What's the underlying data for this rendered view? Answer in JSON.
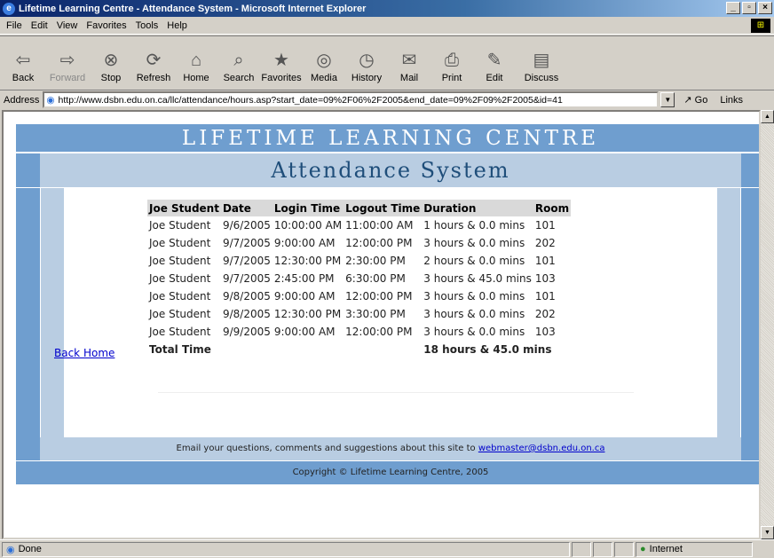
{
  "window": {
    "title": "Lifetime Learning Centre - Attendance System - Microsoft Internet Explorer"
  },
  "menu": [
    "File",
    "Edit",
    "View",
    "Favorites",
    "Tools",
    "Help"
  ],
  "toolbar": [
    {
      "label": "Back",
      "icon": "back-arrow-icon",
      "glyph": "⇦"
    },
    {
      "label": "Forward",
      "icon": "forward-arrow-icon",
      "glyph": "⇨"
    },
    {
      "label": "Stop",
      "icon": "stop-icon",
      "glyph": "⊗"
    },
    {
      "label": "Refresh",
      "icon": "refresh-icon",
      "glyph": "⟳"
    },
    {
      "label": "Home",
      "icon": "home-icon",
      "glyph": "⌂"
    },
    {
      "label": "Search",
      "icon": "search-icon",
      "glyph": "⌕"
    },
    {
      "label": "Favorites",
      "icon": "favorites-icon",
      "glyph": "★"
    },
    {
      "label": "Media",
      "icon": "media-icon",
      "glyph": "◎"
    },
    {
      "label": "History",
      "icon": "history-icon",
      "glyph": "◷"
    },
    {
      "label": "Mail",
      "icon": "mail-icon",
      "glyph": "✉"
    },
    {
      "label": "Print",
      "icon": "print-icon",
      "glyph": "⎙"
    },
    {
      "label": "Edit",
      "icon": "edit-icon",
      "glyph": "✎"
    },
    {
      "label": "Discuss",
      "icon": "discuss-icon",
      "glyph": "▤"
    }
  ],
  "address": {
    "label": "Address",
    "url": "http://www.dsbn.edu.on.ca/llc/attendance/hours.asp?start_date=09%2F06%2F2005&end_date=09%2F09%2F2005&id=41",
    "go": "Go",
    "links": "Links"
  },
  "page": {
    "header_title": "LIFETIME LEARNING CENTRE",
    "subtitle": "Attendance System",
    "columns": [
      "Joe Student",
      "Date",
      "Login Time",
      "Logout Time",
      "Duration",
      "Room"
    ],
    "rows": [
      [
        "Joe Student",
        "9/6/2005",
        "10:00:00 AM",
        "11:00:00 AM",
        "1 hours & 0.0 mins",
        "101"
      ],
      [
        "Joe Student",
        "9/7/2005",
        "9:00:00 AM",
        "12:00:00 PM",
        "3 hours & 0.0 mins",
        "202"
      ],
      [
        "Joe Student",
        "9/7/2005",
        "12:30:00 PM",
        "2:30:00 PM",
        "2 hours & 0.0 mins",
        "101"
      ],
      [
        "Joe Student",
        "9/7/2005",
        "2:45:00 PM",
        "6:30:00 PM",
        "3 hours & 45.0 mins",
        "103"
      ],
      [
        "Joe Student",
        "9/8/2005",
        "9:00:00 AM",
        "12:00:00 PM",
        "3 hours & 0.0 mins",
        "101"
      ],
      [
        "Joe Student",
        "9/8/2005",
        "12:30:00 PM",
        "3:30:00 PM",
        "3 hours & 0.0 mins",
        "202"
      ],
      [
        "Joe Student",
        "9/9/2005",
        "9:00:00 AM",
        "12:00:00 PM",
        "3 hours & 0.0 mins",
        "103"
      ]
    ],
    "total_label": "Total Time",
    "total_value": "18 hours & 45.0 mins",
    "back_home": "Back Home",
    "email_text": "Email your questions, comments and suggestions about this site to",
    "email_link": "webmaster@dsbn.edu.on.ca",
    "copyright": "Copyright © Lifetime Learning Centre, 2005"
  },
  "status": {
    "text": "Done",
    "zone": "Internet"
  },
  "colors": {
    "header_blue": "#6f9ecf",
    "light_blue": "#b9cde2",
    "subtitle_text": "#1f4e7a"
  }
}
